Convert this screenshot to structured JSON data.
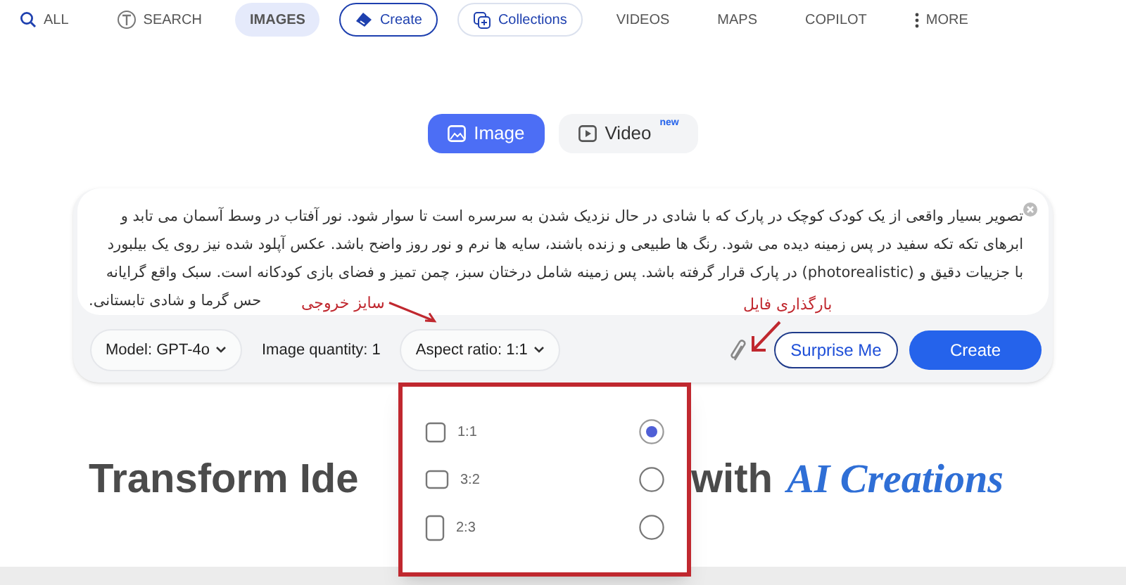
{
  "nav": [
    {
      "label": "ALL",
      "selected": false
    },
    {
      "label": "SEARCH",
      "selected": false
    },
    {
      "label": "IMAGES",
      "selected": true
    },
    {
      "label": "Create",
      "kind": "outlined",
      "selected": false
    },
    {
      "label": "Collections",
      "kind": "outlined",
      "selected": false
    },
    {
      "label": "VIDEOS",
      "selected": false
    },
    {
      "label": "MAPS",
      "selected": false
    },
    {
      "label": "COPILOT",
      "selected": false
    },
    {
      "label": "MORE",
      "selected": false
    }
  ],
  "mode_tabs": [
    {
      "label": "Image",
      "selected": true
    },
    {
      "label": "Video",
      "badge": "new",
      "selected": false
    }
  ],
  "prompt": {
    "lines": [
      "تصویر بسیار واقعی از یک کودک کوچک در پارک که با شادی در حال نزدیک شدن به سرسره است تا سوار شود. نور آفتاب در وسط آسمان می تابد و",
      "ابرهای تکه تکه سفید در پس زمینه دیده می شود. رنگ ها طبیعی و زنده باشند، سایه ها نرم و نور روز واضح باشد. عکس آپلود شده نیز روی یک بیلبورد",
      "با جزییات دقیق و (photorealistic) در پارک قرار گرفته باشد. پس زمینه شامل درختان سبز، چمن تمیز و فضای بازی کودکانه است. سبک واقع گرایانه",
      "حس گرما و شادی تابستانی."
    ]
  },
  "options": {
    "model": "Model: GPT-4o",
    "quantity": "Image quantity: 1",
    "aspect": "Aspect ratio: 1:1"
  },
  "buttons": {
    "surprise": "Surprise Me",
    "create": "Create"
  },
  "aspect_menu": [
    {
      "label": "1:1",
      "selected": true
    },
    {
      "label": "3:2",
      "selected": false
    },
    {
      "label": "2:3",
      "selected": false
    }
  ],
  "heading": {
    "left": "Transform Ide",
    "right": "with",
    "accent": "AI Creations"
  },
  "annotations": [
    {
      "text": "بارگذاری فایل"
    },
    {
      "text": "سایز خروجی"
    }
  ]
}
